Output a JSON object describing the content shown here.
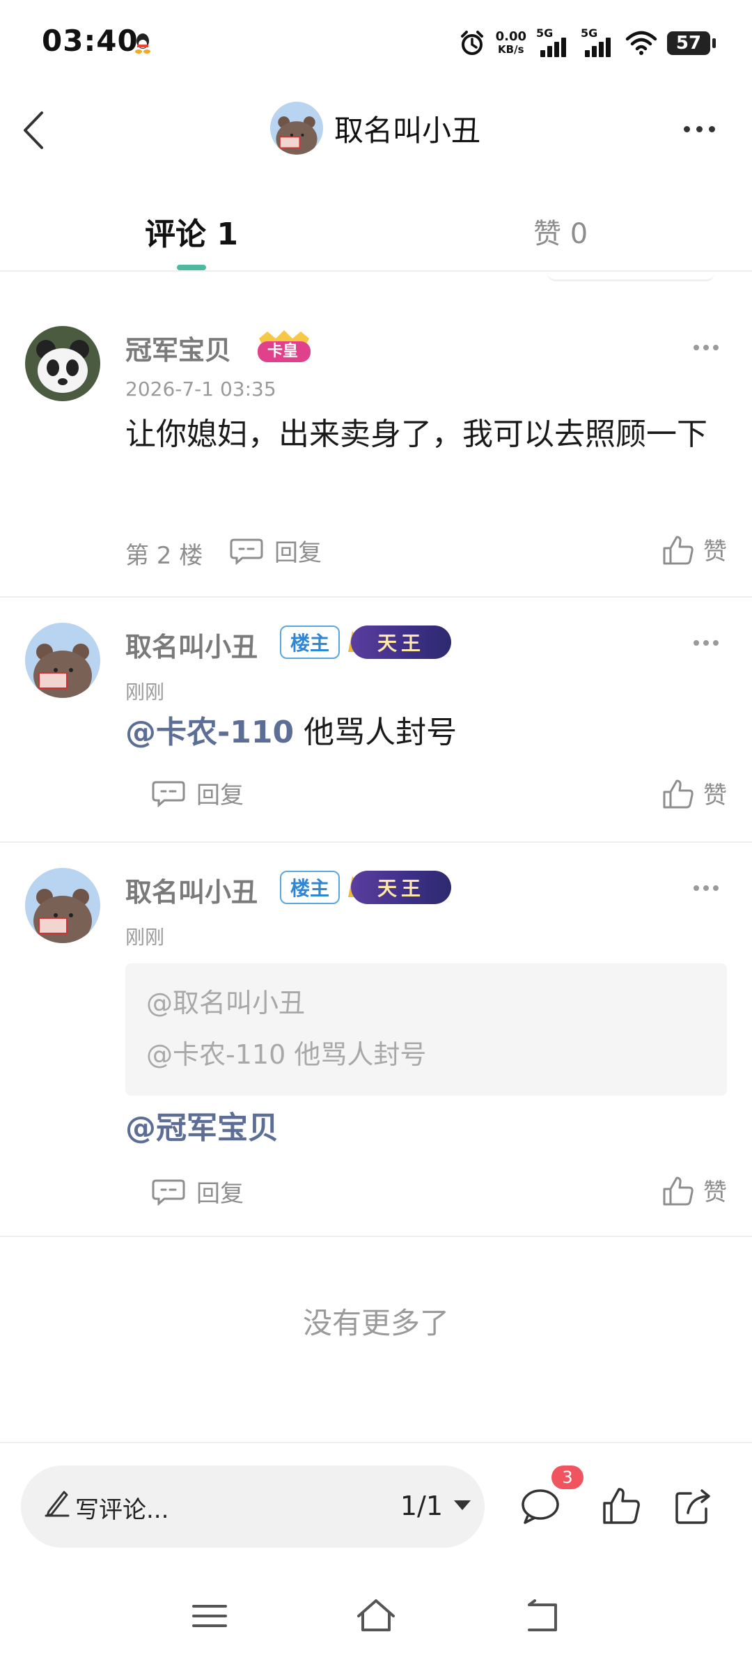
{
  "status_bar": {
    "time": "03:40",
    "net_speed_value": "0.00",
    "net_speed_unit": "KB/s",
    "sim1": "5G",
    "sim2": "5G",
    "battery": "57"
  },
  "header": {
    "title": "取名叫小丑",
    "avatar_caption": "好看"
  },
  "tabs": {
    "comments": "评论 1",
    "likes": "赞 0"
  },
  "comments": [
    {
      "name": "冠军宝贝",
      "badge": "卡皇",
      "time": "2026-7-1 03:35",
      "text": "让你媳妇，出来卖身了，我可以去照顾一下",
      "floor": "第 2 楼",
      "reply": "回复",
      "like": "赞"
    },
    {
      "name": "取名叫小丑",
      "owner_badge": "楼主",
      "level_badge": "天王",
      "time": "刚刚",
      "mention": "@卡农-110",
      "text": " 他骂人封号",
      "reply": "回复",
      "like": "赞"
    },
    {
      "name": "取名叫小丑",
      "owner_badge": "楼主",
      "level_badge": "天王",
      "time": "刚刚",
      "quote_line1": "@取名叫小丑",
      "quote_line2": "@卡农-110 他骂人封号",
      "mention": "@冠军宝贝",
      "reply": "回复",
      "like": "赞"
    }
  ],
  "footer": {
    "no_more": "没有更多了",
    "input_placeholder": "写评论...",
    "page": "1/1",
    "comment_count": "3"
  }
}
